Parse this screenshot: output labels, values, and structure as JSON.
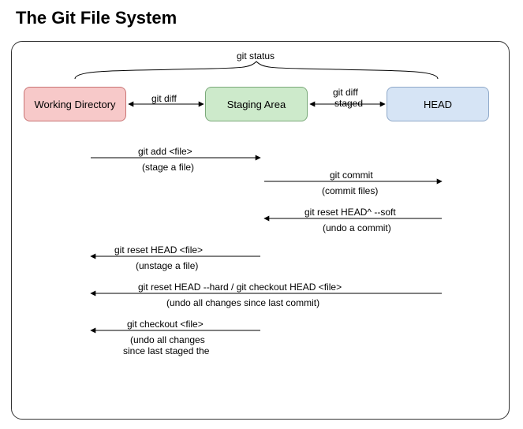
{
  "title": "The Git File System",
  "nodes": {
    "working_directory": "Working Directory",
    "staging_area": "Staging Area",
    "head": "HEAD"
  },
  "brace_label": "git status",
  "arrows": {
    "wd_sa": "git diff",
    "sa_hd_1": "git diff",
    "sa_hd_2": "--staged"
  },
  "cmds": {
    "add": {
      "cmd": "git add <file>",
      "note": "(stage a file)"
    },
    "commit": {
      "cmd": "git commit",
      "note": "(commit files)"
    },
    "reset_soft": {
      "cmd": "git reset HEAD^ --soft",
      "note": "(undo a commit)"
    },
    "reset_file": {
      "cmd": "git reset HEAD <file>",
      "note": "(unstage a file)"
    },
    "reset_hard": {
      "cmd": "git reset HEAD --hard / git checkout HEAD <file>",
      "note": "(undo all changes since last commit)"
    },
    "checkout": {
      "cmd": "git checkout <file>",
      "note1": "(undo all changes",
      "note2": "since last staged the"
    }
  }
}
